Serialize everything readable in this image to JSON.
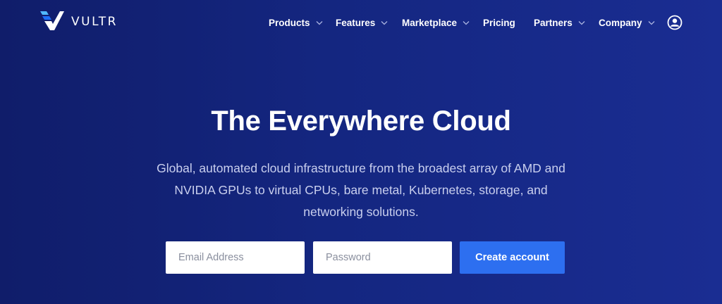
{
  "brand": {
    "name": "VULTR",
    "icon": "vultr-logo-icon"
  },
  "nav": {
    "items": [
      {
        "label": "Products",
        "has_dropdown": true
      },
      {
        "label": "Features",
        "has_dropdown": true
      },
      {
        "label": "Marketplace",
        "has_dropdown": true
      },
      {
        "label": "Pricing",
        "has_dropdown": false
      },
      {
        "label": "Partners",
        "has_dropdown": true
      },
      {
        "label": "Company",
        "has_dropdown": true
      }
    ],
    "account_icon": "user-circle-icon"
  },
  "hero": {
    "title": "The Everywhere Cloud",
    "subtitle": "Global, automated cloud infrastructure from the broadest array of AMD and NVIDIA GPUs to virtual CPUs, bare metal, Kubernetes, storage, and networking solutions."
  },
  "signup": {
    "email_placeholder": "Email Address",
    "password_placeholder": "Password",
    "submit_label": "Create account"
  },
  "colors": {
    "background_start": "#101d6a",
    "background_end": "#1a2d92",
    "accent": "#2d6ff0",
    "subtitle_text": "#c9cfee"
  }
}
